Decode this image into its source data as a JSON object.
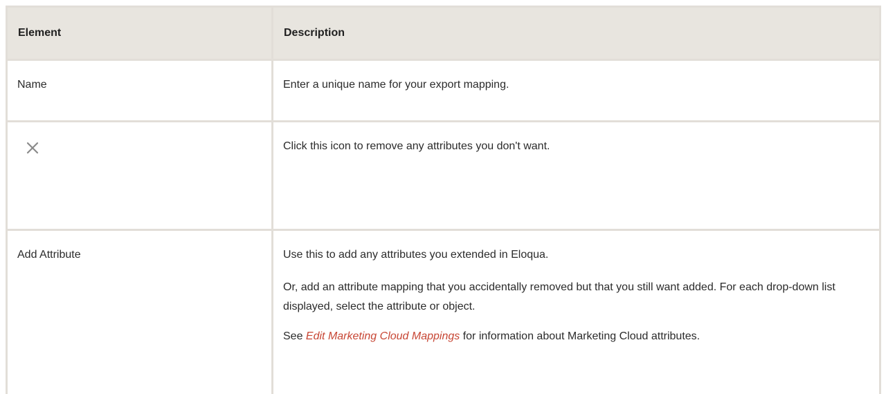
{
  "table": {
    "headers": [
      "Element",
      "Description"
    ],
    "rows": [
      {
        "element": "Name",
        "description": [
          "Enter a unique name for your export mapping."
        ]
      },
      {
        "element_icon": "close-icon",
        "description": [
          "Click this icon to remove any attributes you don't want."
        ]
      },
      {
        "element": "Add Attribute",
        "description": [
          "Use this to add any attributes you extended in Eloqua.",
          "Or, add an attribute mapping that you accidentally removed but that you still want added. For each drop-down list displayed, select the attribute or object."
        ],
        "see": {
          "prefix": "See ",
          "link": "Edit Marketing Cloud Mappings",
          "suffix": " for information about Marketing Cloud attributes."
        }
      }
    ]
  },
  "colors": {
    "header_bg": "#e8e5df",
    "border": "#e2ded8",
    "link": "#c74634",
    "icon": "#8a8a8a"
  }
}
